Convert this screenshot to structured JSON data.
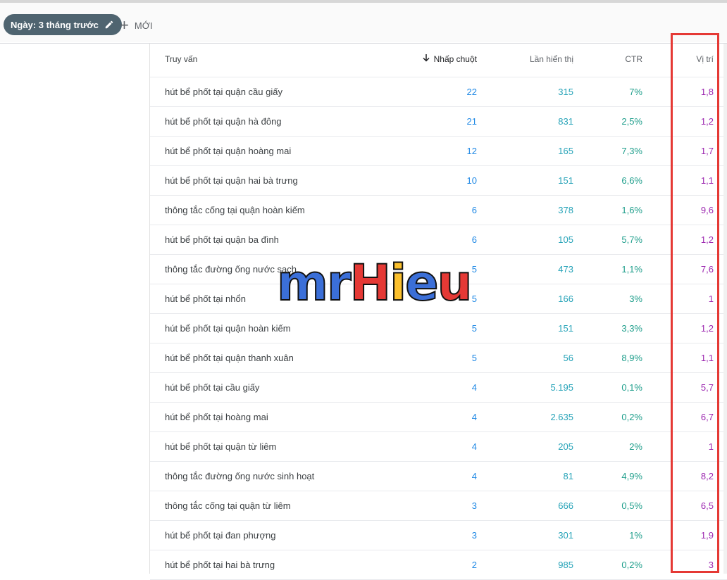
{
  "filter_bar": {
    "date_chip_label": "Ngày: 3 tháng trước",
    "new_label": "MỚI"
  },
  "table": {
    "headers": {
      "query": "Truy vấn",
      "clicks": "Nhấp chuột",
      "impressions": "Lần hiển thị",
      "ctr": "CTR",
      "position": "Vị trí"
    },
    "rows": [
      {
        "query": "hút bể phốt tại quận cầu giấy",
        "clicks": "22",
        "impressions": "315",
        "ctr": "7%",
        "position": "1,8"
      },
      {
        "query": "hút bể phốt tại quận hà đông",
        "clicks": "21",
        "impressions": "831",
        "ctr": "2,5%",
        "position": "1,2"
      },
      {
        "query": "hút bể phốt tại quận hoàng mai",
        "clicks": "12",
        "impressions": "165",
        "ctr": "7,3%",
        "position": "1,7"
      },
      {
        "query": "hút bể phốt tại quận hai bà trưng",
        "clicks": "10",
        "impressions": "151",
        "ctr": "6,6%",
        "position": "1,1"
      },
      {
        "query": "thông tắc cống tại quận hoàn kiếm",
        "clicks": "6",
        "impressions": "378",
        "ctr": "1,6%",
        "position": "9,6"
      },
      {
        "query": "hút bể phốt tại quận ba đình",
        "clicks": "6",
        "impressions": "105",
        "ctr": "5,7%",
        "position": "1,2"
      },
      {
        "query": "thông tắc đường ống nước sạch",
        "clicks": "5",
        "impressions": "473",
        "ctr": "1,1%",
        "position": "7,6"
      },
      {
        "query": "hút bể phốt tại nhổn",
        "clicks": "5",
        "impressions": "166",
        "ctr": "3%",
        "position": "1"
      },
      {
        "query": "hút bể phốt tại quận hoàn kiếm",
        "clicks": "5",
        "impressions": "151",
        "ctr": "3,3%",
        "position": "1,2"
      },
      {
        "query": "hút bể phốt tại quận thanh xuân",
        "clicks": "5",
        "impressions": "56",
        "ctr": "8,9%",
        "position": "1,1"
      },
      {
        "query": "hút bể phốt tại cầu giấy",
        "clicks": "4",
        "impressions": "5.195",
        "ctr": "0,1%",
        "position": "5,7"
      },
      {
        "query": "hút bể phốt tại hoàng mai",
        "clicks": "4",
        "impressions": "2.635",
        "ctr": "0,2%",
        "position": "6,7"
      },
      {
        "query": "hút bể phốt tại quận từ liêm",
        "clicks": "4",
        "impressions": "205",
        "ctr": "2%",
        "position": "1"
      },
      {
        "query": "thông tắc đường ống nước sinh hoạt",
        "clicks": "4",
        "impressions": "81",
        "ctr": "4,9%",
        "position": "8,2"
      },
      {
        "query": "thông tắc cống tại quận từ liêm",
        "clicks": "3",
        "impressions": "666",
        "ctr": "0,5%",
        "position": "6,5"
      },
      {
        "query": "hút bể phốt tại đan phượng",
        "clicks": "3",
        "impressions": "301",
        "ctr": "1%",
        "position": "1,9"
      },
      {
        "query": "hút bể phốt tại hai bà trưng",
        "clicks": "2",
        "impressions": "985",
        "ctr": "0,2%",
        "position": "3"
      }
    ]
  },
  "watermark": {
    "letters": [
      "m",
      "r",
      "H",
      "i",
      "e",
      "u"
    ],
    "colors": [
      "#3b6fd8",
      "#3b6fd8",
      "#e53935",
      "#fbc02d",
      "#3b6fd8",
      "#e53935"
    ]
  },
  "colors": {
    "clicks": "#1e88e5",
    "impressions": "#26a3b8",
    "ctr": "#1e9e8b",
    "position": "#9c27b0",
    "highlight_box": "#e53935"
  }
}
